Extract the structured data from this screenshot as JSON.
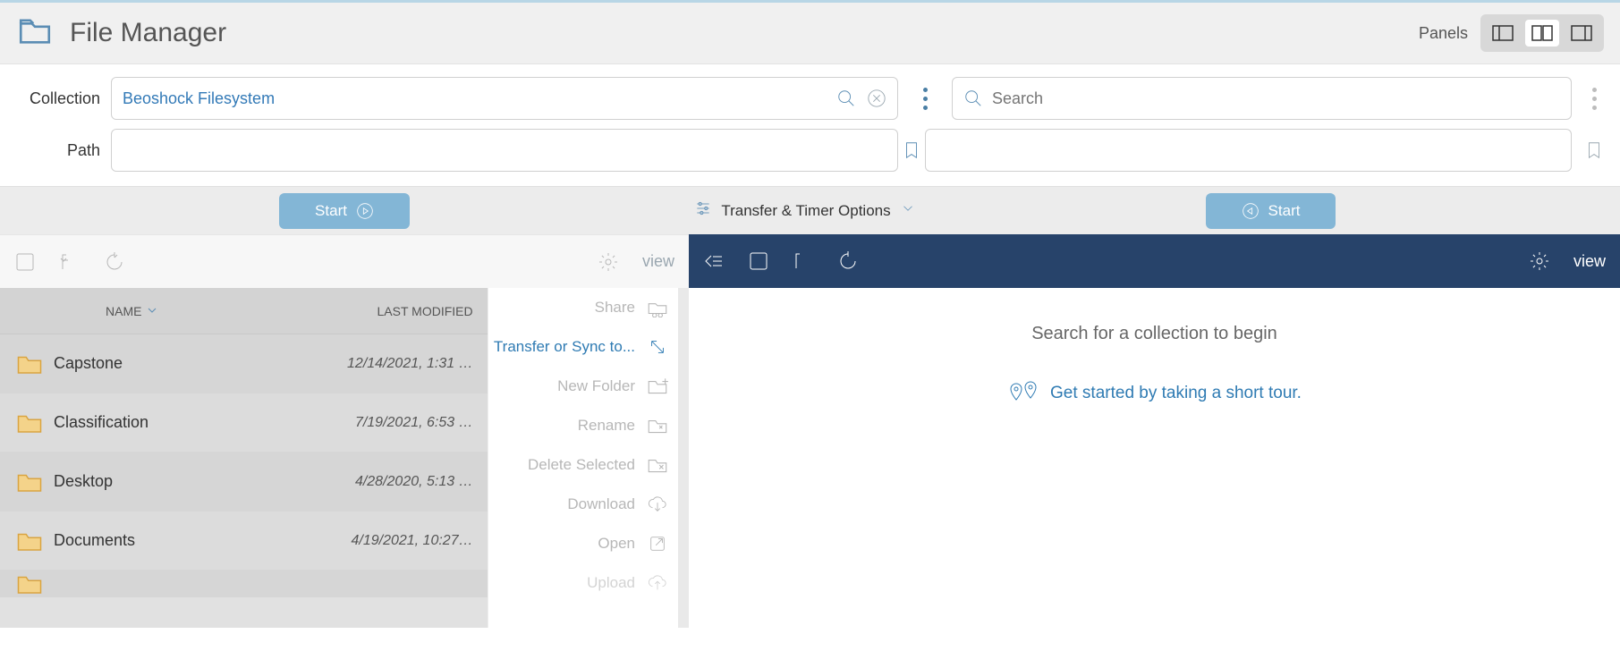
{
  "app": {
    "title": "File Manager",
    "panels_label": "Panels"
  },
  "left": {
    "collection_label": "Collection",
    "collection_value": "Beoshock Filesystem",
    "path_label": "Path",
    "path_value": "",
    "start_label": "Start",
    "view_label": "view",
    "columns": {
      "name": "NAME",
      "modified": "LAST MODIFIED"
    },
    "files": [
      {
        "name": "Capstone",
        "modified": "12/14/2021, 1:31 …"
      },
      {
        "name": "Classification",
        "modified": "7/19/2021, 6:53 …"
      },
      {
        "name": "Desktop",
        "modified": "4/28/2020, 5:13 …"
      },
      {
        "name": "Documents",
        "modified": "4/19/2021, 10:27…"
      }
    ],
    "actions": {
      "share": "Share",
      "transfer": "Transfer or Sync to...",
      "new_folder": "New Folder",
      "rename": "Rename",
      "delete": "Delete Selected",
      "download": "Download",
      "open": "Open",
      "upload": "Upload"
    }
  },
  "center": {
    "options_label": "Transfer & Timer Options"
  },
  "right": {
    "search_placeholder": "Search",
    "start_label": "Start",
    "view_label": "view",
    "empty_msg": "Search for a collection to begin",
    "tour_label": "Get started by taking a short tour."
  }
}
